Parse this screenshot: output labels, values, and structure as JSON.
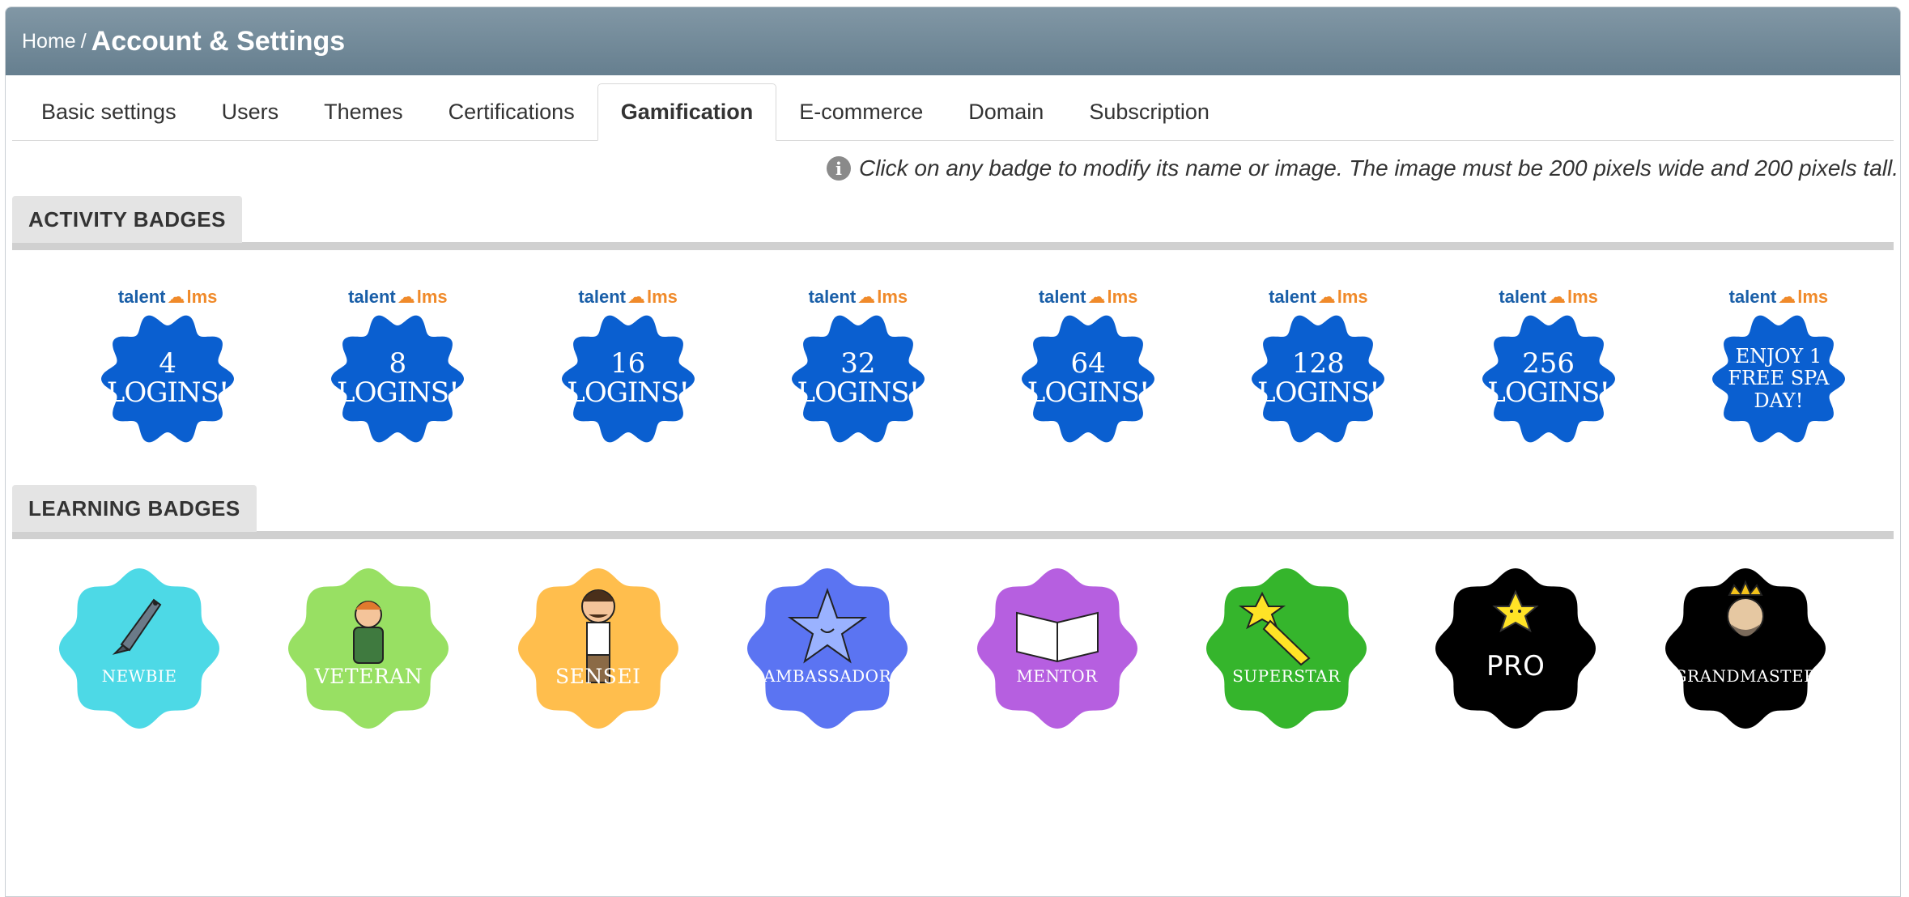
{
  "breadcrumb": {
    "home": "Home",
    "separator": "/",
    "title": "Account & Settings"
  },
  "tabs": [
    {
      "label": "Basic settings",
      "active": false
    },
    {
      "label": "Users",
      "active": false
    },
    {
      "label": "Themes",
      "active": false
    },
    {
      "label": "Certifications",
      "active": false
    },
    {
      "label": "Gamification",
      "active": true
    },
    {
      "label": "E-commerce",
      "active": false
    },
    {
      "label": "Domain",
      "active": false
    },
    {
      "label": "Subscription",
      "active": false
    }
  ],
  "info": {
    "icon": "info-icon",
    "icon_glyph": "i",
    "text": "Click on any badge to modify its name or image. The image must be 200 pixels wide and 200 pixels tall."
  },
  "activity": {
    "heading": "ACTIVITY BADGES",
    "logo": {
      "left": "talent",
      "right": "lms"
    },
    "badge_color": "#0a5fd0",
    "badges": [
      {
        "line1": "4",
        "line2": "LOGINS!"
      },
      {
        "line1": "8",
        "line2": "LOGINS!"
      },
      {
        "line1": "16",
        "line2": "LOGINS!"
      },
      {
        "line1": "32",
        "line2": "LOGINS!"
      },
      {
        "line1": "64",
        "line2": "LOGINS!"
      },
      {
        "line1": "128",
        "line2": "LOGINS!"
      },
      {
        "line1": "256",
        "line2": "LOGINS!"
      },
      {
        "small": "ENJOY 1 FREE SPA DAY!"
      }
    ]
  },
  "learning": {
    "heading": "LEARNING BADGES",
    "badges": [
      {
        "label": "NEWBIE",
        "color": "#4dd9e6",
        "icon": "fish-icon"
      },
      {
        "label": "VETERAN",
        "color": "#98e063",
        "icon": "soldier-icon"
      },
      {
        "label": "SENSEI",
        "color": "#ffbe4d",
        "icon": "sensei-icon"
      },
      {
        "label": "AMBASSADOR",
        "color": "#5b74f2",
        "icon": "star-icon"
      },
      {
        "label": "MENTOR",
        "color": "#b65fe0",
        "icon": "book-icon"
      },
      {
        "label": "SUPERSTAR",
        "color": "#35b52c",
        "icon": "shooting-star-icon"
      },
      {
        "label": "PRO",
        "color": "#000000",
        "icon": "star-character-icon"
      },
      {
        "label": "GRANDMASTER",
        "color": "#000000",
        "icon": "king-icon"
      }
    ]
  }
}
